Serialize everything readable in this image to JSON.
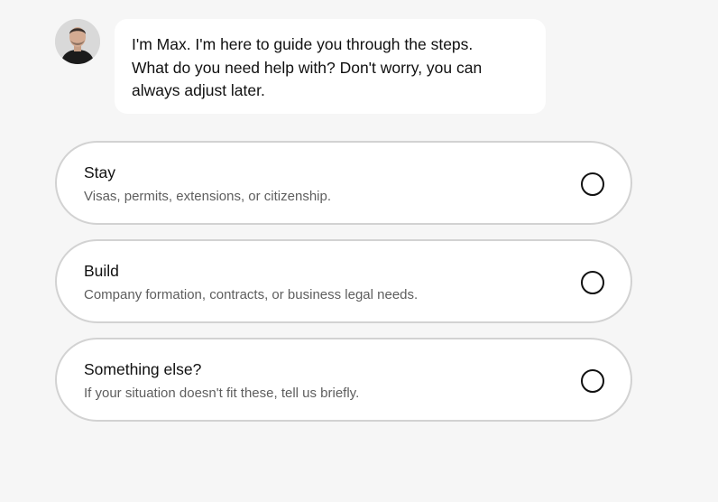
{
  "assistant": {
    "avatar_icon": "person-avatar-icon",
    "message": "I'm Max. I'm here to guide you through the steps.\nWhat do you need help with? Don't worry, you can\nalways adjust later."
  },
  "options": [
    {
      "title": "Stay",
      "description": "Visas, permits, extensions, or citizenship.",
      "selected": false
    },
    {
      "title": "Build",
      "description": "Company formation, contracts, or business legal needs.",
      "selected": false
    },
    {
      "title": "Something else?",
      "description": "If your situation doesn't fit these, tell us briefly.",
      "selected": false
    }
  ],
  "colors": {
    "background": "#f6f6f6",
    "card": "#ffffff",
    "border": "#d2d2d2",
    "description_text": "#5e5e5e"
  }
}
